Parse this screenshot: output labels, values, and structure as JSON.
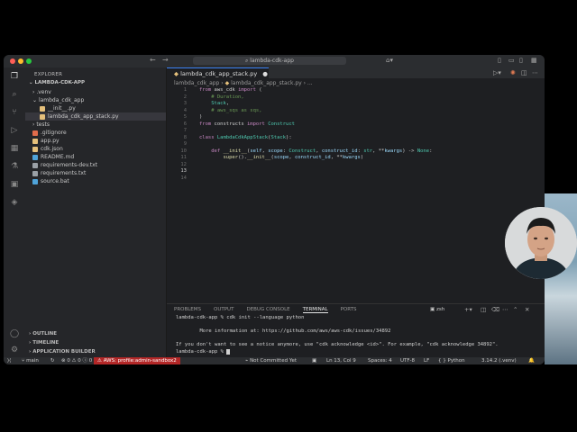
{
  "titlebar": {
    "search_text": "lambda-cdk-app",
    "nav_back": "←",
    "nav_forward": "→"
  },
  "sidebar": {
    "title": "EXPLORER",
    "root": "LAMBDA-CDK-APP",
    "items": [
      {
        "label": ".venv",
        "indent": 1,
        "kind": "folder"
      },
      {
        "label": "lambda_cdk_app",
        "indent": 1,
        "kind": "folder-open"
      },
      {
        "label": "__init__.py",
        "indent": 2,
        "kind": "py"
      },
      {
        "label": "lambda_cdk_app_stack.py",
        "indent": 2,
        "kind": "py",
        "selected": true
      },
      {
        "label": "tests",
        "indent": 1,
        "kind": "folder"
      },
      {
        "label": ".gitignore",
        "indent": 1,
        "kind": "git"
      },
      {
        "label": "app.py",
        "indent": 1,
        "kind": "py"
      },
      {
        "label": "cdk.json",
        "indent": 1,
        "kind": "json"
      },
      {
        "label": "README.md",
        "indent": 1,
        "kind": "md"
      },
      {
        "label": "requirements-dev.txt",
        "indent": 1,
        "kind": "txt"
      },
      {
        "label": "requirements.txt",
        "indent": 1,
        "kind": "txt"
      },
      {
        "label": "source.bat",
        "indent": 1,
        "kind": "bat"
      }
    ],
    "bottom_sections": [
      "OUTLINE",
      "TIMELINE",
      "APPLICATION BUILDER"
    ]
  },
  "editor": {
    "tab_label": "lambda_cdk_app_stack.py",
    "breadcrumb": [
      "lambda_cdk_app",
      "lambda_cdk_app_stack.py",
      "..."
    ],
    "lines": [
      {
        "n": "1",
        "text": "from aws_cdk import ("
      },
      {
        "n": "2",
        "text": "    # Duration,"
      },
      {
        "n": "3",
        "text": "    Stack,"
      },
      {
        "n": "4",
        "text": "    # aws_sqs as sqs,"
      },
      {
        "n": "5",
        "text": ")"
      },
      {
        "n": "6",
        "text": "from constructs import Construct"
      },
      {
        "n": "7",
        "text": ""
      },
      {
        "n": "8",
        "text": "class LambdaCdkAppStack(Stack):"
      },
      {
        "n": "9",
        "text": ""
      },
      {
        "n": "10",
        "text": "    def __init__(self, scope: Construct, construct_id: str, **kwargs) -> None:"
      },
      {
        "n": "11",
        "text": "        super().__init__(scope, construct_id, **kwargs)"
      },
      {
        "n": "12",
        "text": ""
      },
      {
        "n": "13",
        "text": ""
      },
      {
        "n": "14",
        "text": ""
      }
    ]
  },
  "panel": {
    "tabs": [
      "PROBLEMS",
      "OUTPUT",
      "DEBUG CONSOLE",
      "TERMINAL",
      "PORTS"
    ],
    "active_tab": "TERMINAL",
    "shell": "zsh",
    "terminal_lines": [
      "lambda-cdk-app % cdk init --language python",
      "",
      "        More information at: https://github.com/aws/aws-cdk/issues/34892",
      "",
      "If you don't want to see a notice anymore, use \"cdk acknowledge <id>\". For example, \"cdk acknowledge 34892\".",
      "lambda-cdk-app % "
    ]
  },
  "statusbar": {
    "branch": "main",
    "errors": "0",
    "warnings": "0",
    "info": "0",
    "aws_profile": "AWS: profile:admin-sandbox2",
    "git_status": "Not Committed Yet",
    "position": "Ln 13, Col 9",
    "spaces": "Spaces: 4",
    "encoding": "UTF-8",
    "eol": "LF",
    "language": "Python",
    "interpreter": "3.14.2 (.venv)"
  },
  "colors": {
    "accent": "#3b82f6",
    "aws_badge": "#b32727",
    "python_icon": "#e5c07b",
    "folder_icon": "#8a8a8a"
  }
}
